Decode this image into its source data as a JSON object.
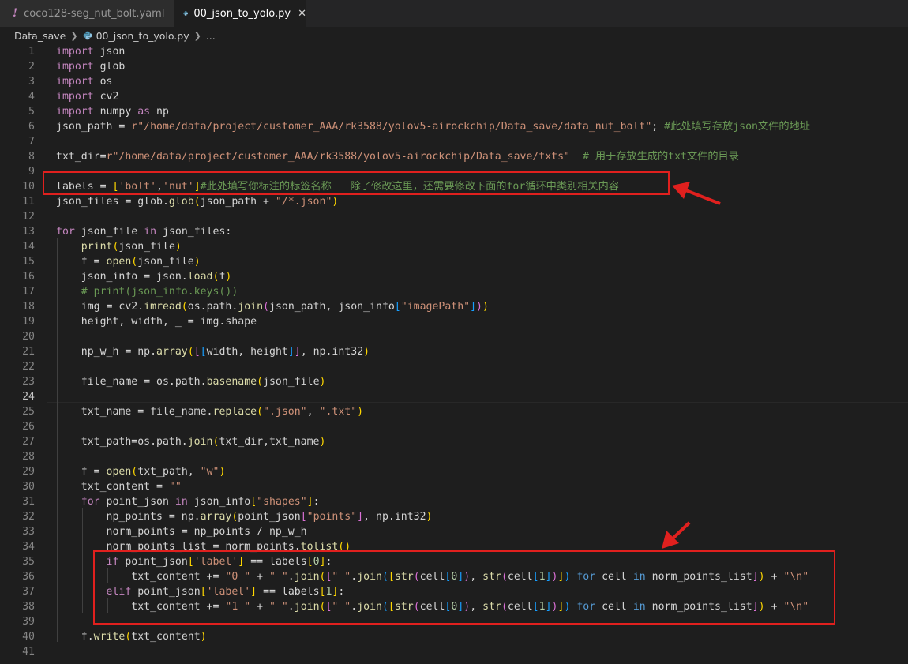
{
  "tabs": [
    {
      "label": "coco128-seg_nut_bolt.yaml",
      "icon": "exclamation-icon"
    },
    {
      "label": "00_json_to_yolo.py",
      "icon": "python-icon",
      "close": "✕"
    }
  ],
  "breadcrumb": {
    "folder": "Data_save",
    "file": "00_json_to_yolo.py",
    "more": "..."
  },
  "editor": {
    "active_line": 24,
    "line_numbers": [
      "1",
      "2",
      "3",
      "4",
      "5",
      "6",
      "7",
      "8",
      "9",
      "10",
      "11",
      "12",
      "13",
      "14",
      "15",
      "16",
      "17",
      "18",
      "19",
      "20",
      "21",
      "22",
      "23",
      "24",
      "25",
      "26",
      "27",
      "28",
      "29",
      "30",
      "31",
      "32",
      "33",
      "34",
      "35",
      "36",
      "37",
      "38",
      "39",
      "40",
      "41"
    ],
    "strings": {
      "json_path": "r\"/home/data/project/customer_AAA/rk3588/yolov5-airockchip/Data_save/data_nut_bolt\"",
      "comment6": "#此处填写存放json文件的地址",
      "txt_dir": "r\"/home/data/project/customer_AAA/rk3588/yolov5-airockchip/Data_save/txts\"",
      "comment8": "# 用于存放生成的txt文件的目录",
      "bolt": "'bolt'",
      "nut": "'nut'",
      "comment10": "#此处填写你标注的标签名称   除了修改这里，还需要修改下面的for循环中类别相关内容",
      "glob_pattern": "\"/*.json\"",
      "comment17": "# print(json_info.keys())",
      "imagePath": "\"imagePath\"",
      "json_ext": "\".json\"",
      "txt_ext": "\".txt\"",
      "mode_w": "\"w\"",
      "empty": "\"\"",
      "shapes": "\"shapes\"",
      "points": "\"points\"",
      "label_key": "'label'",
      "zero_sp": "\"0 \"",
      "one_sp": "\"1 \"",
      "space": "\" \"",
      "newline": "\"\\n\""
    }
  },
  "annotations": {
    "box_color": "#e0201e"
  }
}
